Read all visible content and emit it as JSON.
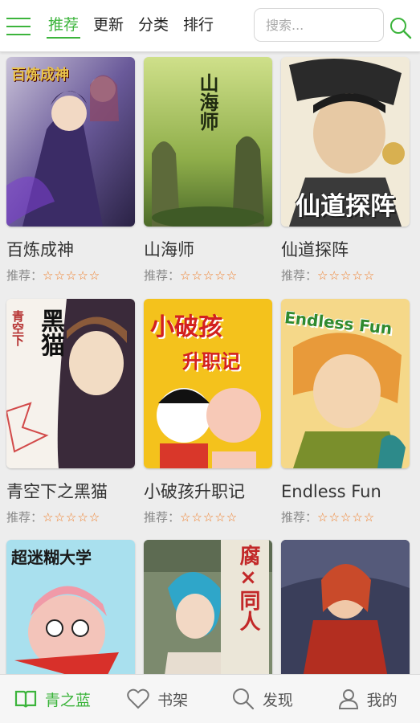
{
  "header": {
    "tabs": [
      {
        "label": "推荐",
        "active": true
      },
      {
        "label": "更新",
        "active": false
      },
      {
        "label": "分类",
        "active": false
      },
      {
        "label": "排行",
        "active": false
      }
    ],
    "search": {
      "placeholder": "搜索..."
    },
    "accent_color": "#3cb43c"
  },
  "comics": [
    {
      "title": "百炼成神",
      "rating_label": "推荐：",
      "stars": "☆☆☆☆☆",
      "cover_text": "百炼成神"
    },
    {
      "title": "山海师",
      "rating_label": "推荐：",
      "stars": "☆☆☆☆☆",
      "cover_text": "山海师"
    },
    {
      "title": "仙道探阵",
      "rating_label": "推荐：",
      "stars": "☆☆☆☆☆",
      "cover_text": "仙道探阵"
    },
    {
      "title": "青空下之黑猫",
      "rating_label": "推荐：",
      "stars": "☆☆☆☆☆",
      "cover_text": "黑猫",
      "cover_subtext": "青空下"
    },
    {
      "title": "小破孩升职记",
      "rating_label": "推荐：",
      "stars": "☆☆☆☆☆",
      "cover_text": "小破孩",
      "cover_subtext": "升职记"
    },
    {
      "title": "Endless Fun",
      "rating_label": "推荐：",
      "stars": "☆☆☆☆☆",
      "cover_text": "Endless Fun"
    },
    {
      "cover_text": "超迷糊大学"
    },
    {
      "cover_text": "腐×同人"
    },
    {
      "cover_text": ""
    }
  ],
  "bottom_nav": [
    {
      "label": "青之蓝",
      "icon": "book-icon",
      "active": true
    },
    {
      "label": "书架",
      "icon": "heart-icon",
      "active": false
    },
    {
      "label": "发现",
      "icon": "search-icon",
      "active": false
    },
    {
      "label": "我的",
      "icon": "user-icon",
      "active": false
    }
  ],
  "colors": {
    "accent": "#3cb43c",
    "star": "#f07a22",
    "background": "#ededed"
  }
}
